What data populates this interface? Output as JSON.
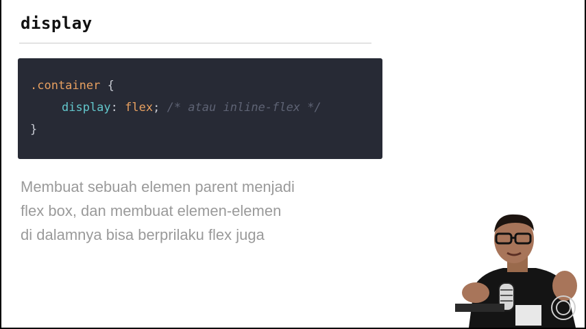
{
  "slide": {
    "title": "display",
    "code": {
      "selector": ".container",
      "open_brace": " {",
      "property": "display",
      "colon": ": ",
      "value": "flex",
      "semicolon": ";",
      "comment": " /* atau inline-flex */",
      "close_brace": "}"
    },
    "description": [
      "Membuat sebuah elemen parent menjadi",
      "flex box, dan membuat elemen-elemen",
      "di dalamnya bisa berprilaku flex juga"
    ]
  },
  "colors": {
    "code_background": "#272a35",
    "selector": "#e8a060",
    "property": "#63c7cc",
    "comment": "#5e6374",
    "description_text": "#9a9a9a"
  }
}
